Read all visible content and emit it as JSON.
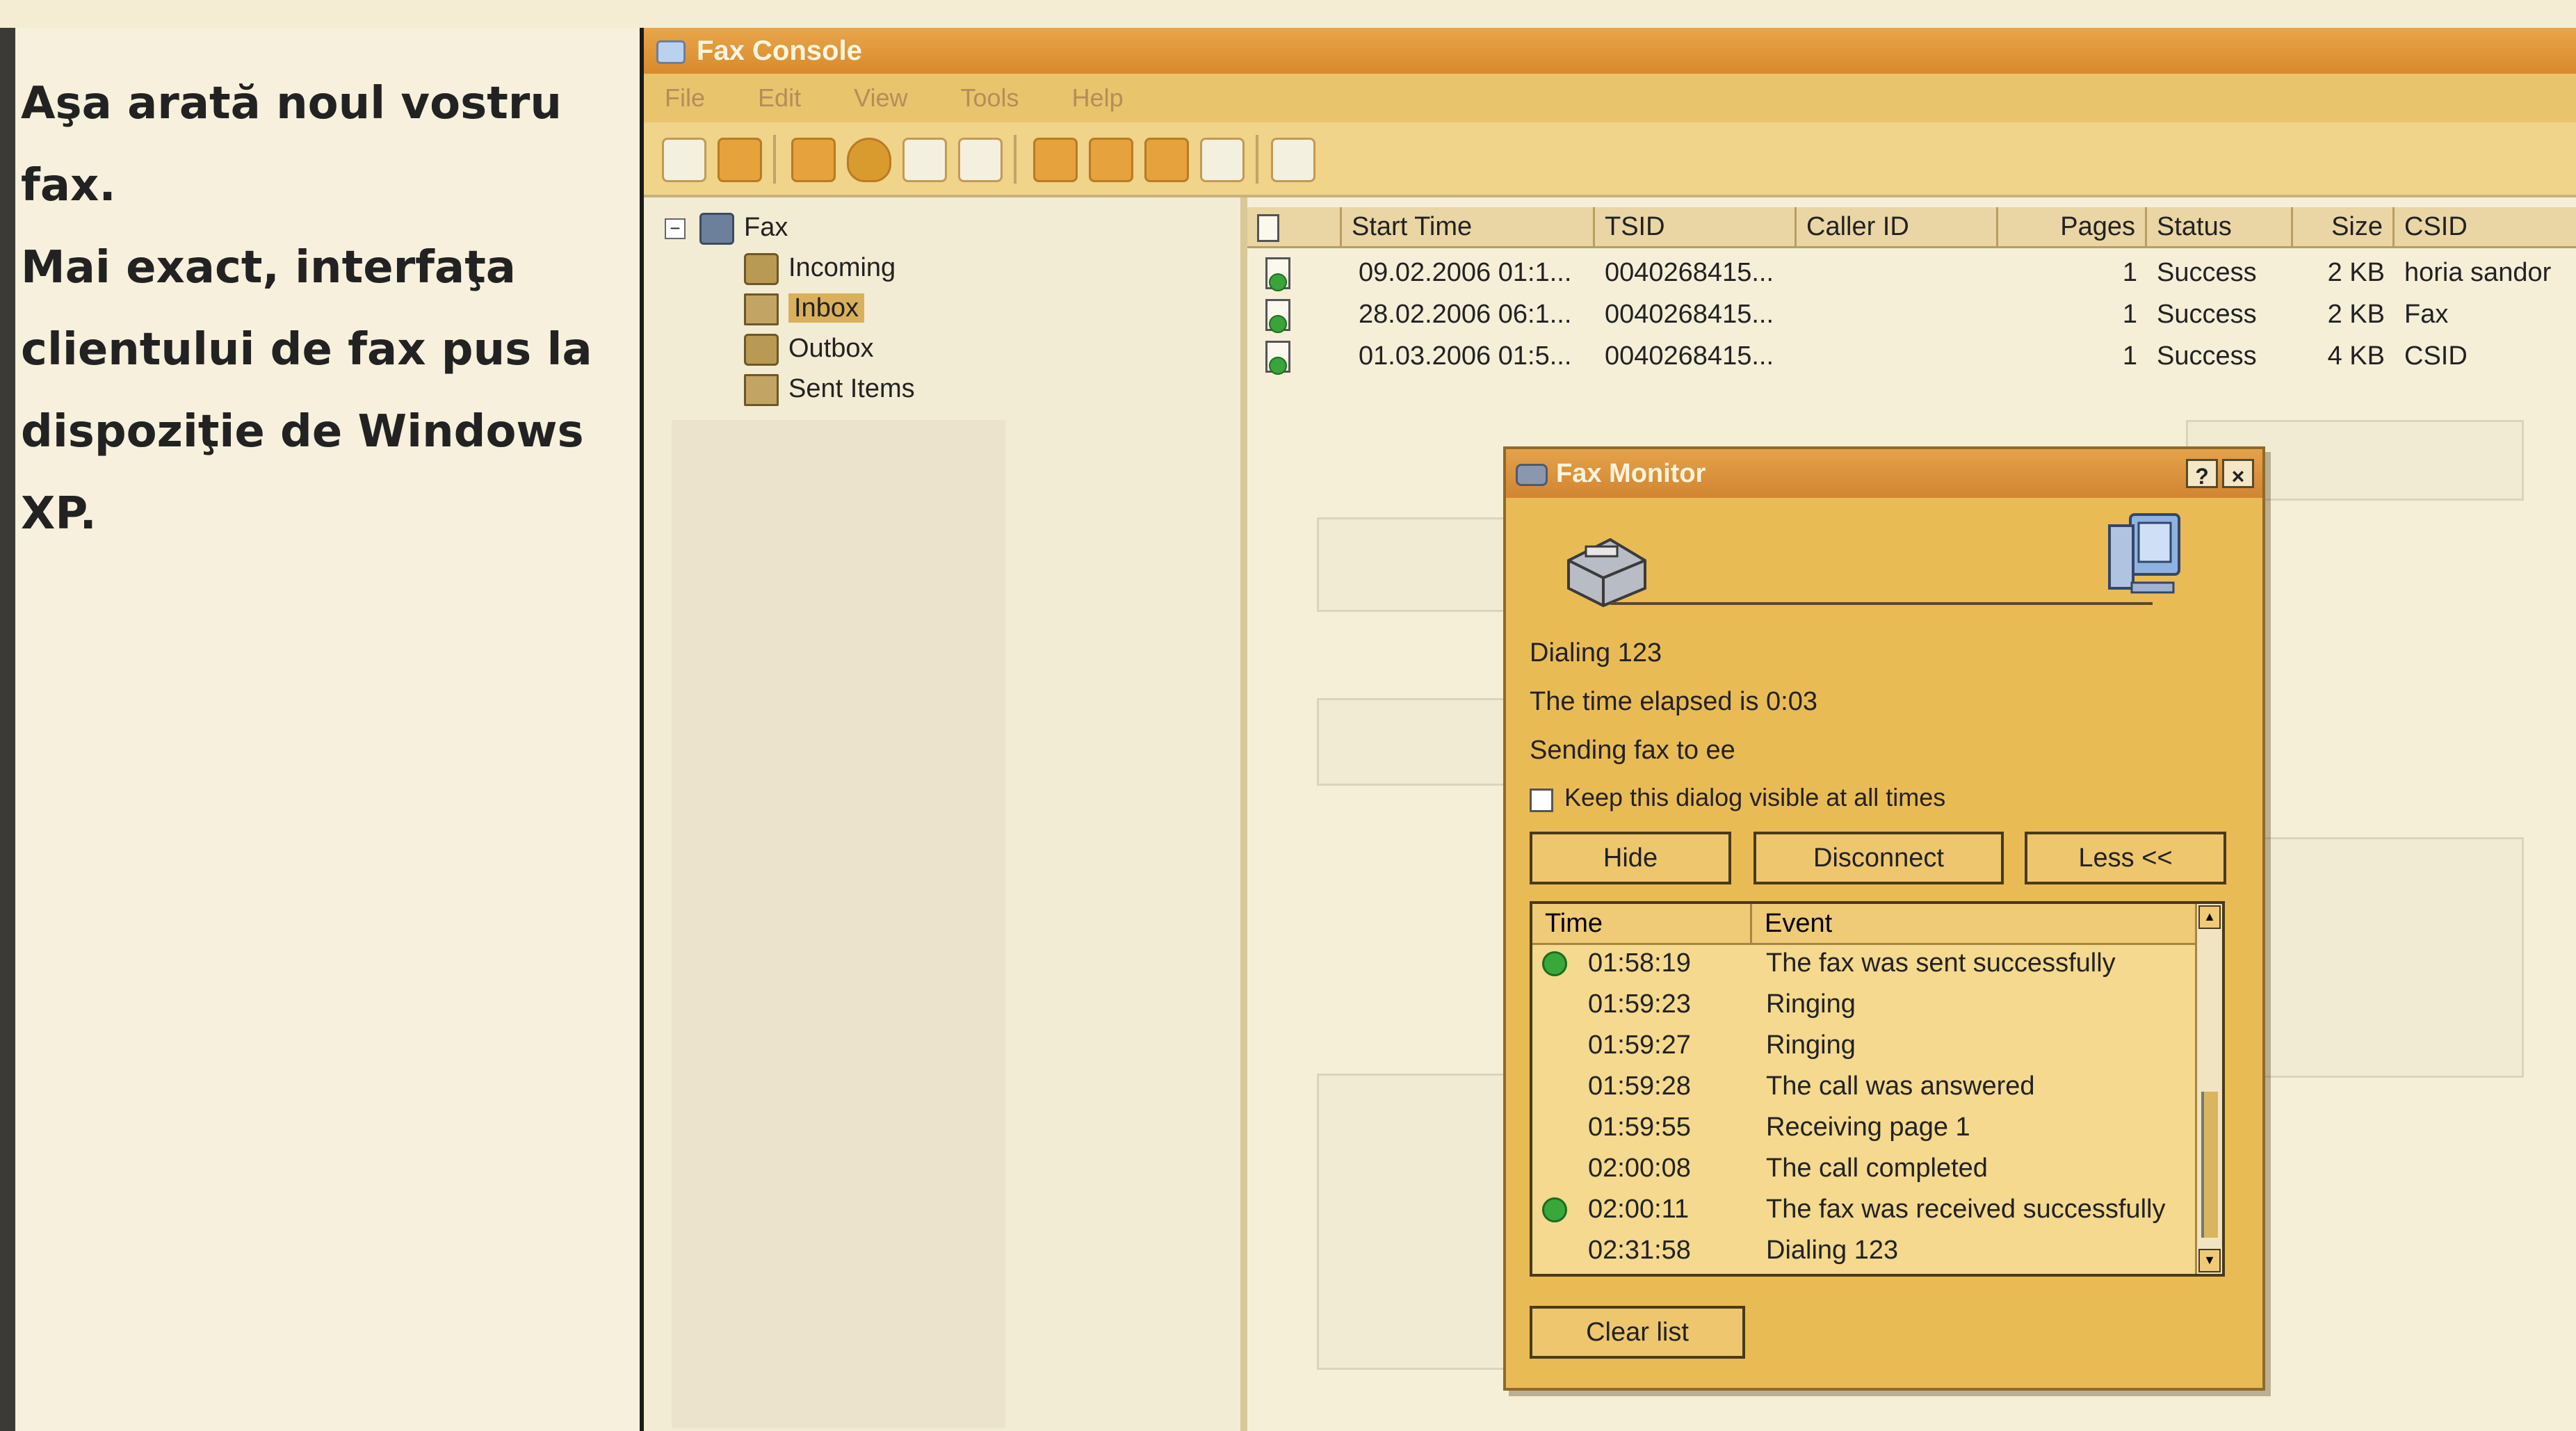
{
  "caption": {
    "text": "Aşa arată noul vostru fax.\nMai exact, interfaţa\nclientului de fax pus la\ndispoziţie de Windows XP."
  },
  "console": {
    "title": "Fax Console",
    "menu": [
      "File",
      "Edit",
      "View",
      "Tools",
      "Help"
    ],
    "tree": {
      "root": "Fax",
      "items": [
        "Incoming",
        "Inbox",
        "Outbox",
        "Sent Items"
      ]
    },
    "columns": [
      "Start Time",
      "TSID",
      "Caller ID",
      "Pages",
      "Status",
      "Size",
      "CSID"
    ],
    "rows": [
      {
        "start": "09.02.2006 01:1...",
        "tsid": "0040268415...",
        "caller": "",
        "pages": "1",
        "status": "Success",
        "size": "2 KB",
        "csid": "horia sandor"
      },
      {
        "start": "28.02.2006 06:1...",
        "tsid": "0040268415...",
        "caller": "",
        "pages": "1",
        "status": "Success",
        "size": "2 KB",
        "csid": "Fax"
      },
      {
        "start": "01.03.2006 01:5...",
        "tsid": "0040268415...",
        "caller": "",
        "pages": "1",
        "status": "Success",
        "size": "4 KB",
        "csid": "CSID"
      }
    ]
  },
  "monitor": {
    "title": "Fax Monitor",
    "help_label": "?",
    "close_label": "×",
    "status": {
      "dialing": "Dialing 123",
      "elapsed": "The time elapsed is 0:03",
      "sending": "Sending fax to ee"
    },
    "keep_visible_label": "Keep this dialog visible at all times",
    "keep_visible_checked": false,
    "buttons": {
      "hide": "Hide",
      "disconnect": "Disconnect",
      "less": "Less <<",
      "clear": "Clear list"
    },
    "event_columns": [
      "Time",
      "Event"
    ],
    "events": [
      {
        "time": "01:58:19",
        "text": "The fax was sent successfully",
        "icon": "success-icon"
      },
      {
        "time": "01:59:23",
        "text": "Ringing",
        "icon": ""
      },
      {
        "time": "01:59:27",
        "text": "Ringing",
        "icon": ""
      },
      {
        "time": "01:59:28",
        "text": "The call was answered",
        "icon": ""
      },
      {
        "time": "01:59:55",
        "text": "Receiving page 1",
        "icon": ""
      },
      {
        "time": "02:00:08",
        "text": "The call completed",
        "icon": ""
      },
      {
        "time": "02:00:11",
        "text": "The fax was received successfully",
        "icon": "success-icon"
      },
      {
        "time": "02:31:58",
        "text": "Dialing 123",
        "icon": ""
      }
    ]
  },
  "colors": {
    "title_bar": "#d88a2c",
    "dialog_face": "#e9bb55",
    "success_green": "#39a83a"
  }
}
